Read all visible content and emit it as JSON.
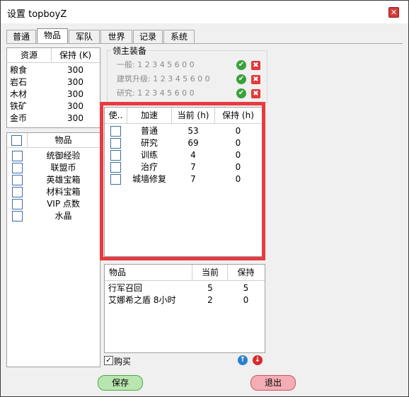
{
  "window": {
    "title": "设置 topboyZ",
    "close_glyph": "✕"
  },
  "tabs": [
    "普通",
    "物品",
    "军队",
    "世界",
    "记录",
    "系统"
  ],
  "resources": {
    "headers": [
      "资源",
      "保持 (K)"
    ],
    "rows": [
      {
        "name": "粮食",
        "value": "300"
      },
      {
        "name": "岩石",
        "value": "300"
      },
      {
        "name": "木材",
        "value": "300"
      },
      {
        "name": "铁矿",
        "value": "300"
      },
      {
        "name": "金币",
        "value": "300"
      }
    ]
  },
  "items": {
    "header": "物品",
    "rows": [
      "统御经验",
      "联盟币",
      "英雄宝箱",
      "材料宝箱",
      "VIP 点数",
      "水晶"
    ]
  },
  "lord_equipment": {
    "title": "领主装备",
    "rows": [
      "一般: 1 2 3 4 5 6 0 0",
      "建筑升级: 1 2 3 4 5 6 0 0",
      "研究: 1 2 3 4 5 6 0 0"
    ],
    "ok_glyph": "✔",
    "no_glyph": "✖"
  },
  "speedup": {
    "headers": [
      "使..",
      "加速",
      "当前 (h)",
      "保持 (h)"
    ],
    "rows": [
      {
        "name": "普通",
        "current": "53",
        "keep": "0"
      },
      {
        "name": "研究",
        "current": "69",
        "keep": "0"
      },
      {
        "name": "训练",
        "current": "4",
        "keep": "0"
      },
      {
        "name": "治疗",
        "current": "7",
        "keep": "0"
      },
      {
        "name": "城墙修复",
        "current": "7",
        "keep": "0"
      }
    ]
  },
  "purchase": {
    "headers": [
      "物品",
      "当前",
      "保持"
    ],
    "rows": [
      {
        "name": "行军召回",
        "current": "5",
        "keep": "5"
      },
      {
        "name": "艾娜希之盾 8小时",
        "current": "2",
        "keep": "0"
      }
    ],
    "buy_label": "购买",
    "buy_check": "✓",
    "up_glyph": "↑",
    "down_glyph": "↓"
  },
  "buttons": {
    "save": "保存",
    "exit": "退出"
  },
  "colors": {
    "highlight": "#e83a40",
    "ok": "#3aa13a",
    "no": "#e23a3a",
    "save_bg": "#b9e6b0",
    "exit_bg": "#f2aeb4"
  }
}
